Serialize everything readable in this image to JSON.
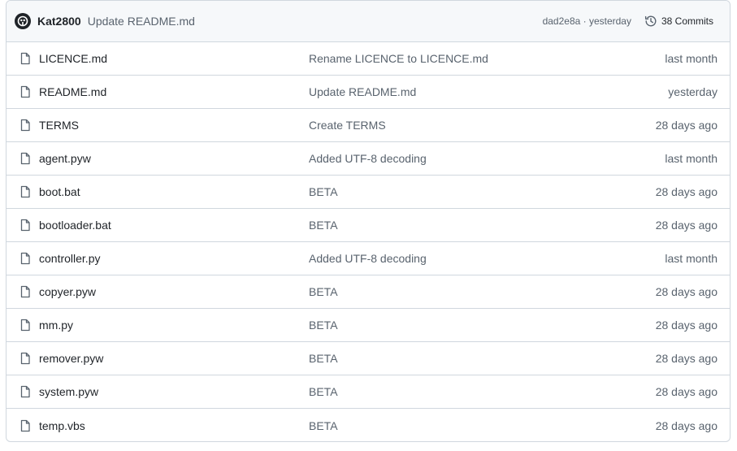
{
  "header": {
    "author": "Kat2800",
    "message": "Update README.md",
    "sha_time": "dad2e8a · yesterday",
    "commits": "38 Commits"
  },
  "files": [
    {
      "name": "LICENCE.md",
      "message": "Rename LICENCE to LICENCE.md",
      "date": "last month"
    },
    {
      "name": "README.md",
      "message": "Update README.md",
      "date": "yesterday"
    },
    {
      "name": "TERMS",
      "message": "Create TERMS",
      "date": "28 days ago"
    },
    {
      "name": "agent.pyw",
      "message": "Added UTF-8 decoding",
      "date": "last month"
    },
    {
      "name": "boot.bat",
      "message": "BETA",
      "date": "28 days ago"
    },
    {
      "name": "bootloader.bat",
      "message": "BETA",
      "date": "28 days ago"
    },
    {
      "name": "controller.py",
      "message": "Added UTF-8 decoding",
      "date": "last month"
    },
    {
      "name": "copyer.pyw",
      "message": "BETA",
      "date": "28 days ago"
    },
    {
      "name": "mm.py",
      "message": "BETA",
      "date": "28 days ago"
    },
    {
      "name": "remover.pyw",
      "message": "BETA",
      "date": "28 days ago"
    },
    {
      "name": "system.pyw",
      "message": "BETA",
      "date": "28 days ago"
    },
    {
      "name": "temp.vbs",
      "message": "BETA",
      "date": "28 days ago"
    }
  ],
  "icons": {
    "file": "file-icon",
    "history": "history-icon",
    "avatar": "avatar-icon"
  }
}
